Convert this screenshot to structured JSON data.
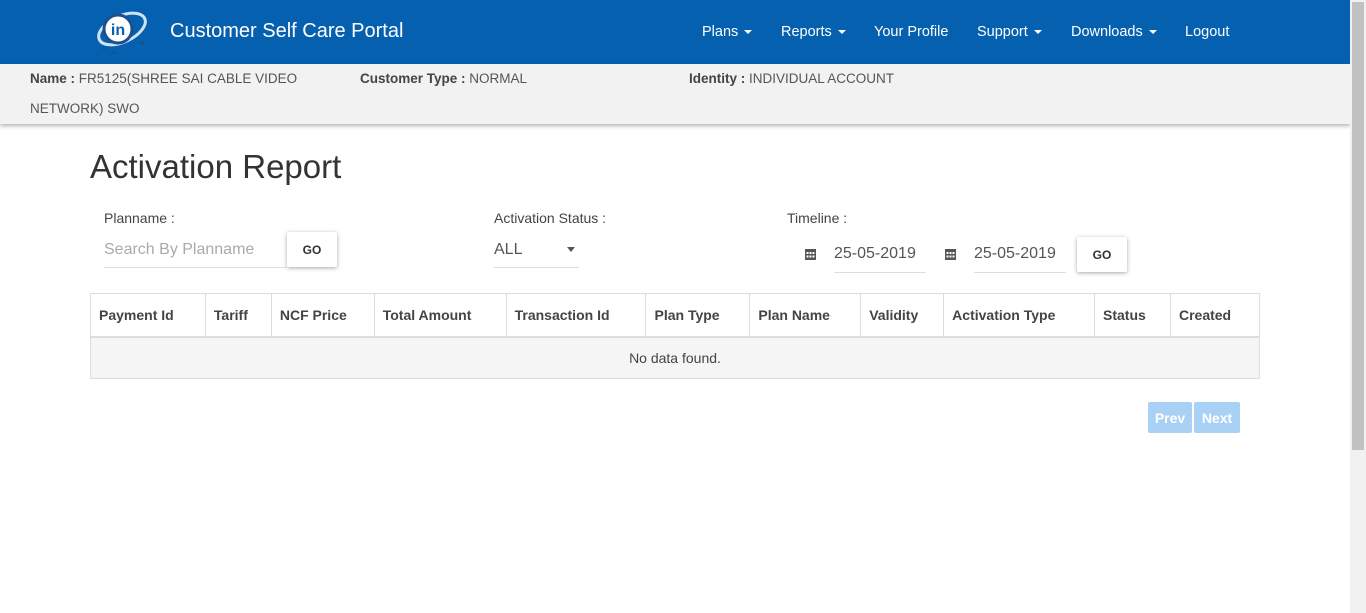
{
  "header": {
    "brand": "Customer Self Care Portal",
    "nav": [
      {
        "label": "Plans"
      },
      {
        "label": "Reports"
      },
      {
        "label": "Your Profile"
      },
      {
        "label": "Support"
      },
      {
        "label": "Downloads"
      },
      {
        "label": "Logout"
      }
    ]
  },
  "customer": {
    "name_label": "Name :",
    "name_line1": "FR5125(SHREE SAI CABLE VIDEO",
    "name_line2": "NETWORK) SWO",
    "type_label": "Customer Type :",
    "type_value": "NORMAL",
    "identity_label": "Identity :",
    "identity_value": "INDIVIDUAL ACCOUNT"
  },
  "page": {
    "title": "Activation Report"
  },
  "filters": {
    "planname_label": "Planname :",
    "planname_placeholder": "Search By Planname",
    "go_label": "GO",
    "status_label": "Activation Status :",
    "status_value": "ALL",
    "timeline_label": "Timeline :",
    "from_date": "25-05-2019",
    "to_date": "25-05-2019"
  },
  "table": {
    "columns": [
      "Payment Id",
      "Tariff",
      "NCF Price",
      "Total Amount",
      "Transaction Id",
      "Plan Type",
      "Plan Name",
      "Validity",
      "Activation Type",
      "Status",
      "Created"
    ],
    "empty_message": "No data found."
  },
  "pagination": {
    "prev": "Prev",
    "next": "Next"
  },
  "colors": {
    "navbar": "#0660b0",
    "pagination_disabled": "#a9d1f5"
  }
}
